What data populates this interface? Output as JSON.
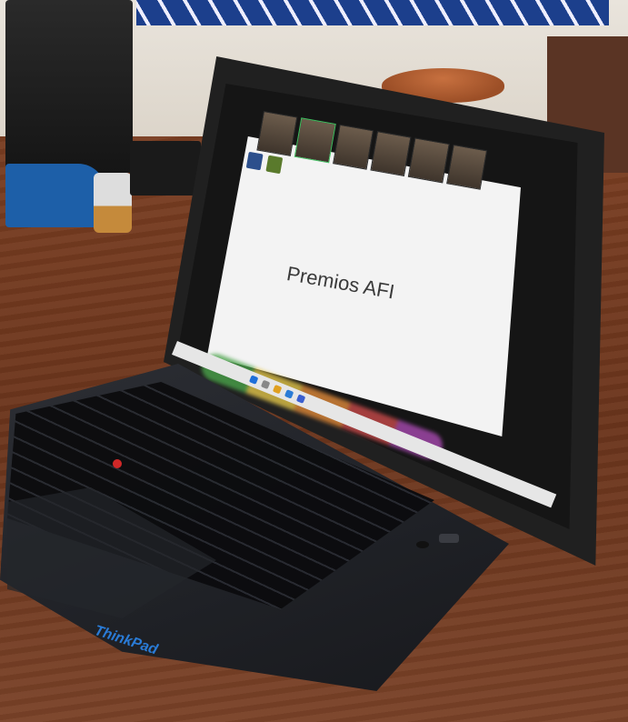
{
  "slide": {
    "title": "Premios AFI"
  },
  "laptop": {
    "brand": "ThinkPad"
  },
  "colors": {
    "table": "#6b351c",
    "laptop_body": "#1f2126",
    "slide_bg": "#f3f3f3",
    "trackpoint": "#d02828",
    "brand_blue": "#2a7bd6"
  },
  "icons": [
    "trackpoint-icon",
    "power-button-icon",
    "fingerprint-reader-icon"
  ]
}
